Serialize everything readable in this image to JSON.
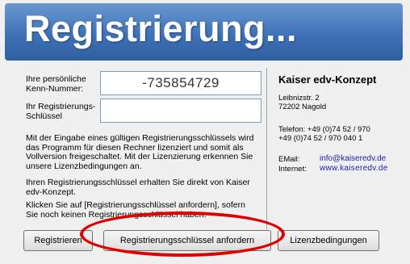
{
  "header": {
    "title": "Registrierung..."
  },
  "form": {
    "id_label_1": "Ihre persönliche",
    "id_label_2": "Kenn-Nummer:",
    "id_value": "-735854729",
    "key_label_1": "Ihr Registrierungs-",
    "key_label_2": "Schlüssel",
    "key_value": ""
  },
  "info": {
    "p1_l1": "Mit der Eingabe eines gültigen Registrierungsschlüssels wird",
    "p1_l2": "das Programm für diesen Rechner lizenziert und somit als",
    "p1_l3": "Vollversion freigeschaltet. Mit der Lizenzierung erkennen Sie",
    "p1_l4": "unsere Lizenzbedingungen an.",
    "p2_l1": "Ihren Registrierungsschlüssel erhalten Sie direkt von Kaiser",
    "p2_l2": "edv-Konzept.",
    "p3_l1": "Klicken Sie auf [Registrierungsschlüssel anfordern], sofern",
    "p3_l2": "Sie noch keinen Registrierungsschlüssel haben."
  },
  "company": {
    "name": "Kaiser edv-Konzept",
    "street": "Leibnizstr. 2",
    "city": "72202 Nagold",
    "phone_l1": "Telefon: +49 (0)74 52 / 970",
    "phone_l2": "+49 (0)74 52 / 970 040 1",
    "email_label": "EMail:",
    "email": "info@kaiseredv.de",
    "internet_label": "Internet:",
    "internet": "www.kaiseredv.de"
  },
  "buttons": {
    "register": "Registrieren",
    "request_key": "Registrierungsschlüssel anfordern",
    "license": "Lizenzbedingungen"
  },
  "annotation": {
    "color": "#e00000"
  }
}
